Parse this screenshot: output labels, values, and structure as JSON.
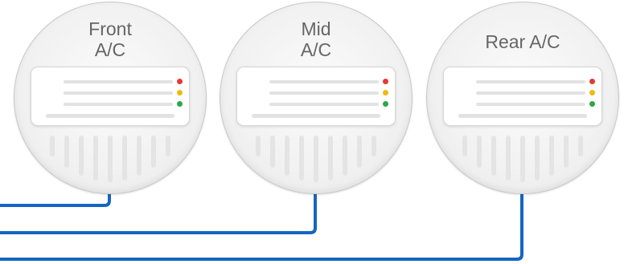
{
  "units": [
    {
      "title": "Front\nA/C",
      "leds": [
        "red",
        "yellow",
        "green"
      ]
    },
    {
      "title": "Mid\nA/C",
      "leds": [
        "red",
        "yellow",
        "green"
      ]
    },
    {
      "title": "Rear A/C",
      "leds": [
        "red",
        "yellow",
        "green"
      ]
    }
  ],
  "colors": {
    "wire": "#1565c0",
    "led_red": "#e53935",
    "led_yellow": "#f2b90d",
    "led_green": "#2aa94a"
  }
}
